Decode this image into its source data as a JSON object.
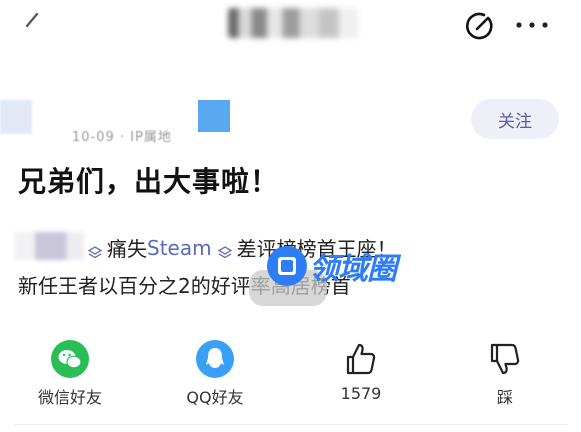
{
  "header": {
    "back_icon": "pen-slash-icon",
    "edit_icon": "edit-circle-icon",
    "more_icon": "more-dots-icon"
  },
  "author": {
    "meta": "10-09 · IP属地",
    "follow_label": "关注"
  },
  "post": {
    "title": "兄弟们，出大事啦！",
    "line1_part1": "痛失",
    "line1_link": "Steam",
    "line1_part2": "差评榜榜首王座！",
    "line2": "新任王者以百分之2的好评率高居榜首"
  },
  "watermark": {
    "text": "领域圈"
  },
  "actions": {
    "wechat_label": "微信好友",
    "qq_label": "QQ好友",
    "like_count": "1579",
    "dislike_label": "踩"
  },
  "colors": {
    "wechat_green": "#2bbd56",
    "qq_blue": "#3aa0f5",
    "follow_text": "#575da8",
    "follow_bg": "#efeff7",
    "link": "#5b6ab8",
    "watermark": "#2e7cf6"
  }
}
